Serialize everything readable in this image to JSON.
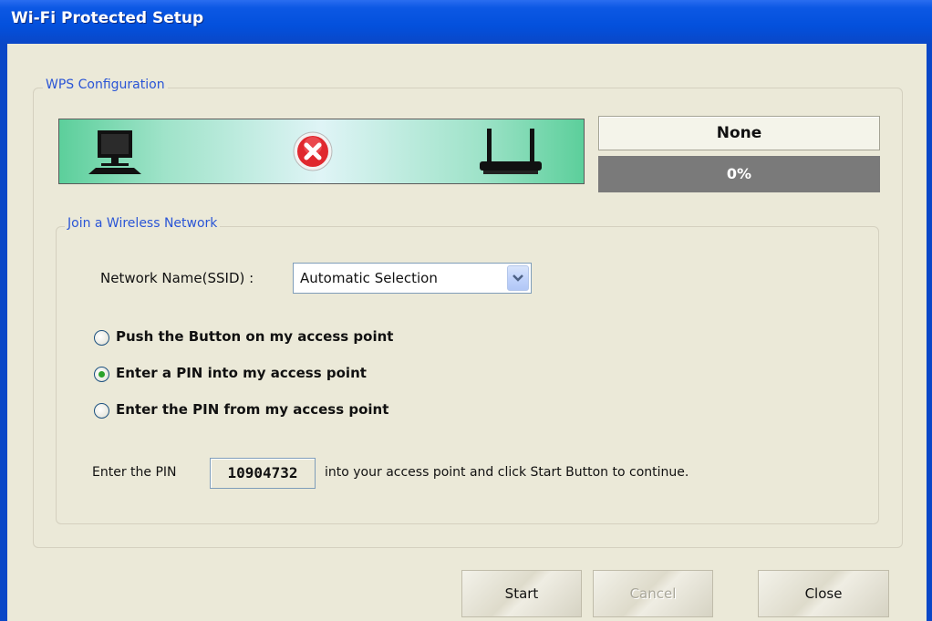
{
  "window": {
    "title": "Wi-Fi Protected Setup"
  },
  "wps": {
    "group_title": "WPS Configuration",
    "status": "None",
    "progress_label": "0%",
    "progress_fraction": 0
  },
  "join": {
    "group_title": "Join a Wireless Network",
    "ssid_label": "Network Name(SSID) :",
    "ssid_value": "Automatic Selection",
    "options": [
      {
        "label": "Push the Button on my access point",
        "selected": false
      },
      {
        "label": "Enter a PIN into my access point",
        "selected": true
      },
      {
        "label": "Enter the PIN from my access point",
        "selected": false
      }
    ],
    "pin_prefix": "Enter the PIN",
    "pin_value": "10904732",
    "pin_suffix": "into your access point and click Start Button to continue."
  },
  "buttons": {
    "start": "Start",
    "cancel": "Cancel",
    "close": "Close"
  },
  "icons": {
    "computer": "computer-icon",
    "status": "error-x-icon",
    "router": "router-icon"
  },
  "colors": {
    "titlebar": "#0350dc",
    "legend": "#2a55d6",
    "error_red": "#e0282e",
    "radio_dot": "#2aa22a",
    "progress_bg": "#7a7a7a"
  }
}
